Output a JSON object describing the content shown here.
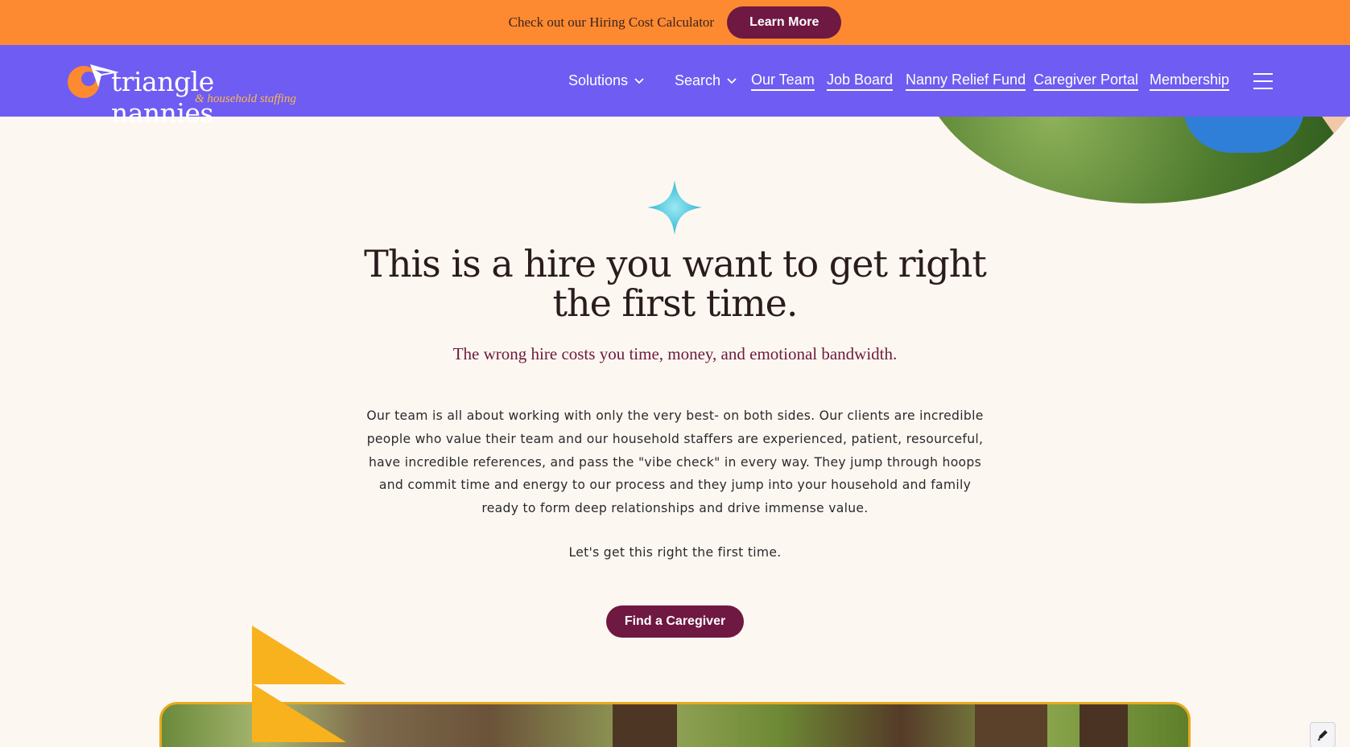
{
  "announcement": {
    "text": "Check out our Hiring Cost Calculator",
    "button_label": "Learn More"
  },
  "brand": {
    "name": "triangle nannies",
    "tagline": "& household staffing"
  },
  "nav": {
    "dropdowns": [
      "Solutions",
      "Search"
    ],
    "links": [
      "Our Team",
      "Job Board",
      "Nanny Relief Fund",
      "Caregiver Portal",
      "Membership"
    ]
  },
  "hero": {
    "headline_line1": "This is a hire you want to get right",
    "headline_line2": "the first time.",
    "subheadline": "The wrong hire costs you time, money, and emotional bandwidth.",
    "body": "Our team is all about working with only the very best- on both sides. Our clients are incredible people who value their team and our household staffers are experienced, patient, resourceful, have incredible references, and pass the \"vibe check\" in every way. They jump through hoops and commit time and energy to our process and they jump into your household and family ready to form deep relationships and drive immense value.",
    "closing": "Let's get this right the first time.",
    "cta_label": "Find a Caregiver"
  },
  "colors": {
    "announcement_bg": "#fd8a30",
    "nav_bg": "#6f5cf2",
    "page_bg": "#fdf7f2",
    "button_bg": "#6e1842",
    "sparkle": "#3cc3d8",
    "triangle_accent": "#f7b21e"
  },
  "icons": {
    "dropdown": "chevron-down-icon",
    "menu": "hamburger-icon",
    "sparkle": "sparkle-icon",
    "edit": "pen-icon"
  }
}
